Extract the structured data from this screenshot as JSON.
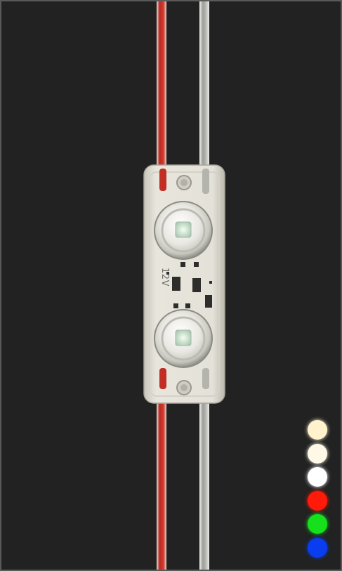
{
  "module": {
    "voltage_label": "12V",
    "wire_colors": {
      "positive": "#c9372c",
      "negative": "#b9b9b4"
    },
    "housing_color": "#e3e1d7",
    "lens_count": 2
  },
  "color_options": [
    {
      "name": "warm-white",
      "color": "#fff2cc"
    },
    {
      "name": "natural-white",
      "color": "#fff8e6"
    },
    {
      "name": "cool-white",
      "color": "#ffffff"
    },
    {
      "name": "red",
      "color": "#ff1a0a"
    },
    {
      "name": "green",
      "color": "#16e01c"
    },
    {
      "name": "blue",
      "color": "#0a3df0"
    }
  ]
}
